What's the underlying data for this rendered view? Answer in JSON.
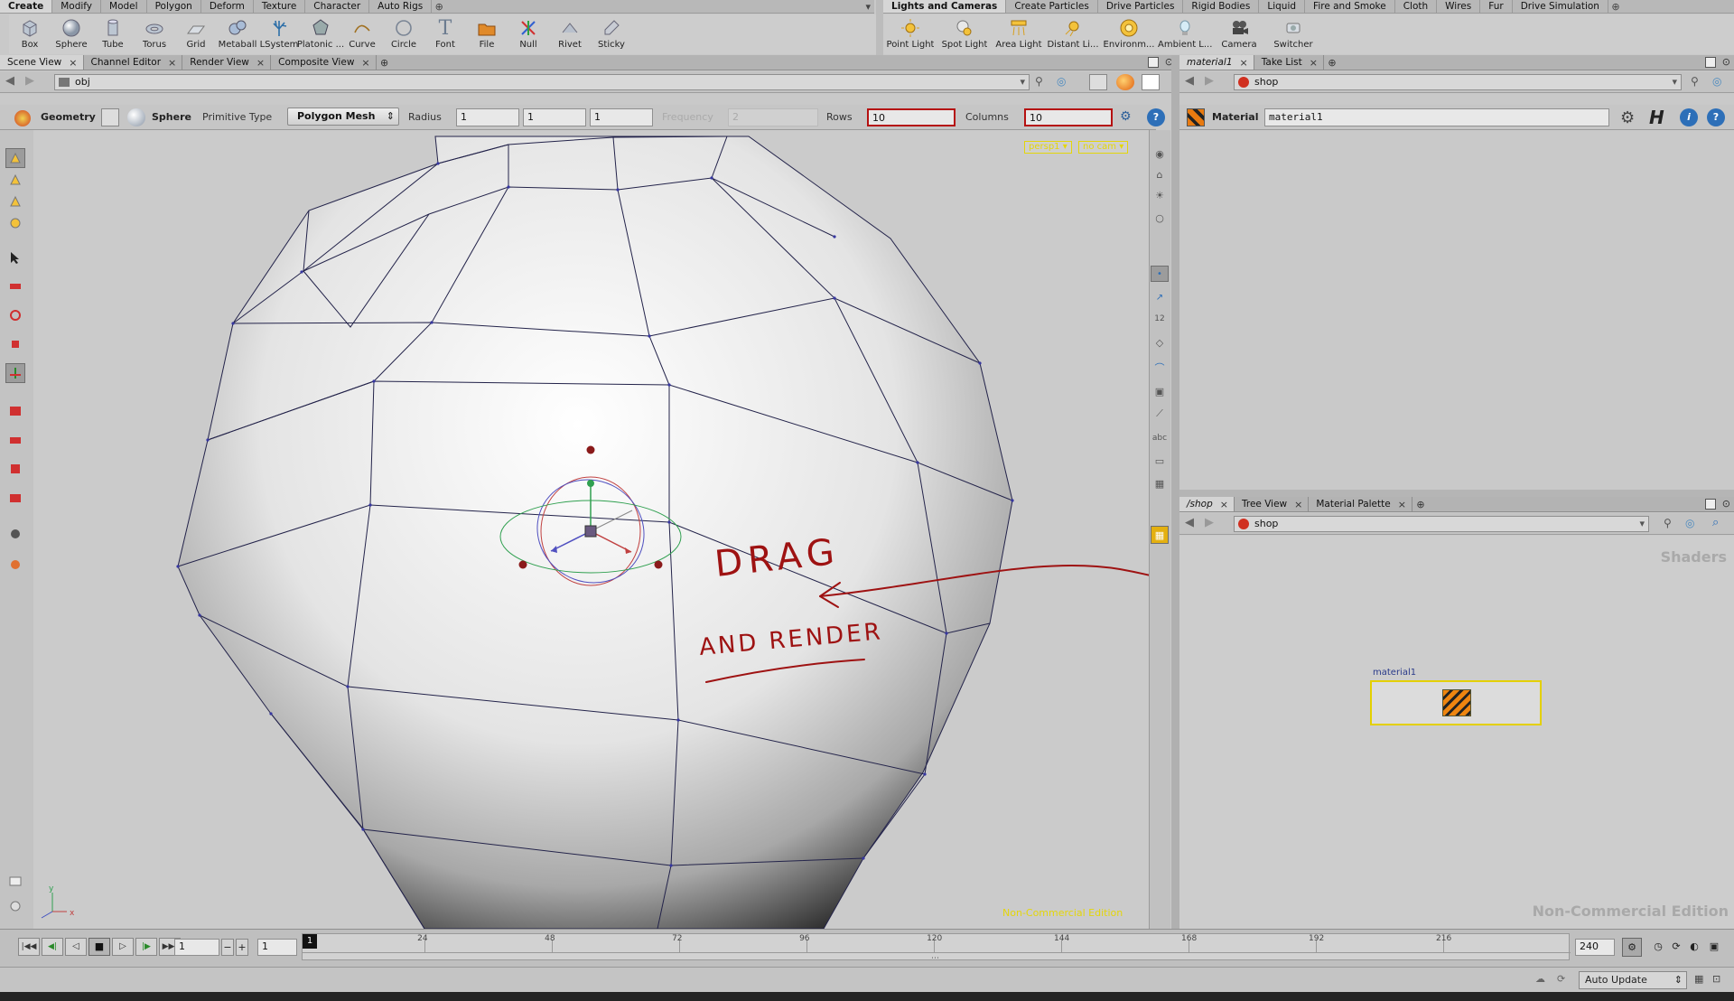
{
  "shelf_left": {
    "tabs": [
      "Create",
      "Modify",
      "Model",
      "Polygon",
      "Deform",
      "Texture",
      "Character",
      "Auto Rigs"
    ],
    "tools": [
      {
        "label": "Box",
        "icon": "box-icon"
      },
      {
        "label": "Sphere",
        "icon": "sphere-icon"
      },
      {
        "label": "Tube",
        "icon": "tube-icon"
      },
      {
        "label": "Torus",
        "icon": "torus-icon"
      },
      {
        "label": "Grid",
        "icon": "grid-icon"
      },
      {
        "label": "Metaball",
        "icon": "metaball-icon"
      },
      {
        "label": "LSystem",
        "icon": "lsystem-icon"
      },
      {
        "label": "Platonic ...",
        "icon": "platonic-icon"
      },
      {
        "label": "Curve",
        "icon": "curve-icon"
      },
      {
        "label": "Circle",
        "icon": "circle-icon"
      },
      {
        "label": "Font",
        "icon": "font-icon"
      },
      {
        "label": "File",
        "icon": "file-icon"
      },
      {
        "label": "Null",
        "icon": "null-icon"
      },
      {
        "label": "Rivet",
        "icon": "rivet-icon"
      },
      {
        "label": "Sticky",
        "icon": "sticky-icon"
      }
    ]
  },
  "shelf_right": {
    "tabs": [
      "Lights and Cameras",
      "Create Particles",
      "Drive Particles",
      "Rigid Bodies",
      "Liquid",
      "Fire and Smoke",
      "Cloth",
      "Wires",
      "Fur",
      "Drive Simulation"
    ],
    "tools": [
      {
        "label": "Point Light",
        "icon": "point-light-icon"
      },
      {
        "label": "Spot Light",
        "icon": "spot-light-icon"
      },
      {
        "label": "Area Light",
        "icon": "area-light-icon"
      },
      {
        "label": "Distant Li...",
        "icon": "distant-light-icon"
      },
      {
        "label": "Environm...",
        "icon": "environment-light-icon"
      },
      {
        "label": "Ambient L...",
        "icon": "ambient-light-icon"
      },
      {
        "label": "Camera",
        "icon": "camera-icon"
      },
      {
        "label": "Switcher",
        "icon": "switcher-icon"
      }
    ]
  },
  "scene_pane": {
    "tabs": [
      "Scene View",
      "Channel Editor",
      "Render View",
      "Composite View"
    ],
    "path": "obj",
    "op": {
      "context": "Geometry",
      "node": "Sphere",
      "primitive_type_label": "Primitive Type",
      "primitive_type_value": "Polygon Mesh",
      "radius_label": "Radius",
      "radius": [
        "1",
        "1",
        "1"
      ],
      "frequency_label": "Frequency",
      "frequency": "2",
      "rows_label": "Rows",
      "rows": "10",
      "columns_label": "Columns",
      "columns": "10"
    },
    "viewport": {
      "camera_menu": "persp1",
      "cam_menu": "no cam",
      "watermark": "Non-Commercial Edition",
      "annotation_line1": "DRAG",
      "annotation_line2": "AND RENDER",
      "axis_x": "x",
      "axis_y": "y"
    }
  },
  "param_pane": {
    "tabs": [
      "material1",
      "Take List"
    ],
    "path": "shop",
    "node_type": "Material",
    "node_name": "material1"
  },
  "network_pane": {
    "tabs": [
      "/shop",
      "Tree View",
      "Material Palette"
    ],
    "path": "shop",
    "header": "Shaders",
    "node_label": "material1",
    "watermark": "Non-Commercial Edition"
  },
  "timeline": {
    "current_frame": "1",
    "start_frame": "1",
    "marker_frame": "1",
    "end_frame": "240",
    "ticks": [
      "24",
      "48",
      "72",
      "96",
      "120",
      "144",
      "168",
      "192",
      "216"
    ],
    "tick_values": [
      24,
      48,
      72,
      96,
      120,
      144,
      168,
      192,
      216
    ],
    "range_min": 1,
    "range_max": 240
  },
  "status": {
    "update_mode": "Auto Update"
  },
  "colors": {
    "accent_red": "#b51010",
    "warn_yellow": "#e4d60a",
    "ui_bg": "#c9c9c9",
    "viewport_bg": "#c9c9c9"
  }
}
